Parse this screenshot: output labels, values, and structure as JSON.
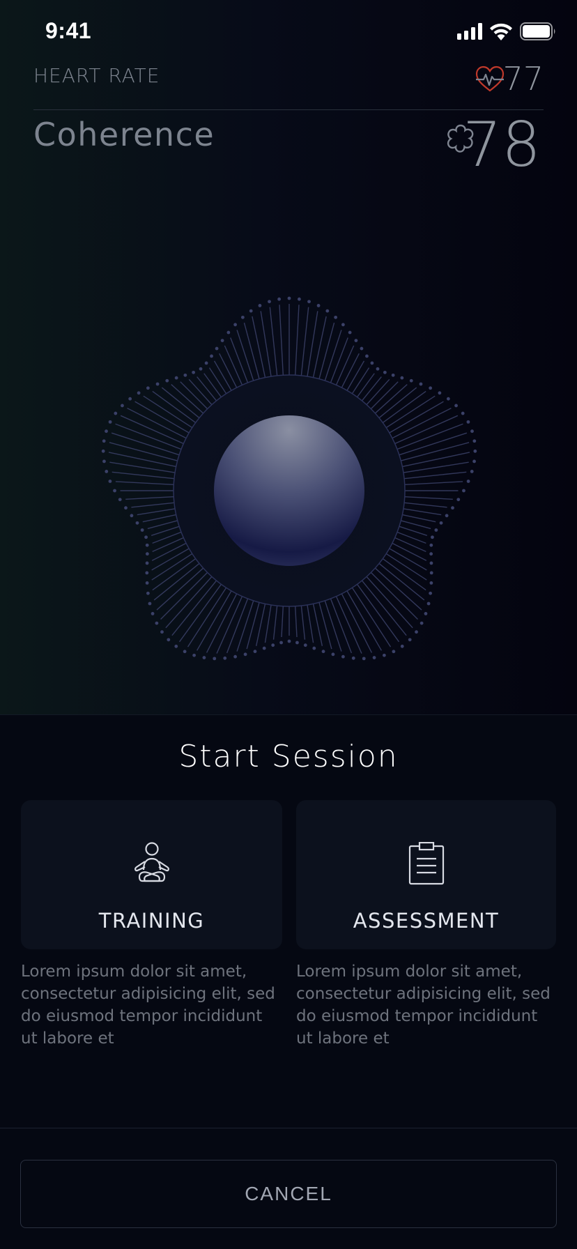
{
  "status_bar": {
    "time": "9:41"
  },
  "heart_rate": {
    "label": "HEART RATE",
    "value": "77",
    "icon": "heart-pulse-icon"
  },
  "coherence": {
    "label": "Coherence",
    "value": "78",
    "icon": "flower-icon"
  },
  "sheet": {
    "title": "Start Session",
    "options": [
      {
        "label": "TRAINING",
        "icon": "meditation-icon",
        "description": "Lorem ipsum dolor sit amet, consectetur adipisicing elit, sed do eiusmod tempor incididunt ut labore et"
      },
      {
        "label": "ASSESSMENT",
        "icon": "clipboard-icon",
        "description": "Lorem ipsum dolor sit amet, consectetur adipisicing elit, sed do eiusmod tempor incididunt ut labore et"
      }
    ],
    "cancel_label": "CANCEL"
  },
  "colors": {
    "accent_heart": "#c0392b",
    "ray": "#3b4168",
    "orb_top": "#7a7f93",
    "orb_bottom": "#161a45"
  }
}
